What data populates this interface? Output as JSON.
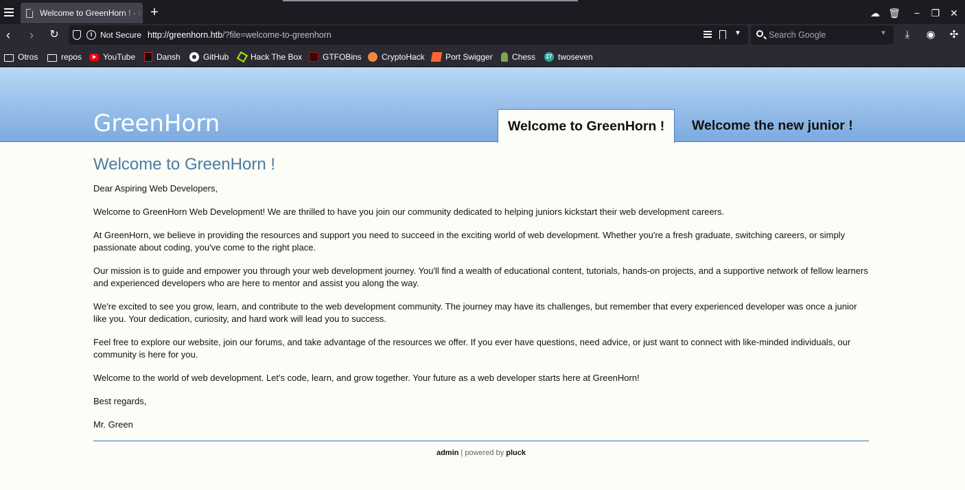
{
  "browser": {
    "tab_title": "Welcome to GreenHorn ! - GreenHorn",
    "new_tab_icon": "plus-icon",
    "url_security": "Not Secure",
    "url_host": "http://greenhorn.htb",
    "url_path": "/?file=welcome-to-greenhorn",
    "search_placeholder": "Search Google",
    "bookmarks": [
      {
        "label": "Otros",
        "icon": "folder-icon"
      },
      {
        "label": "repos",
        "icon": "folder-icon"
      },
      {
        "label": "YouTube",
        "icon": "youtube-icon"
      },
      {
        "label": "Dansh",
        "icon": "dansh-icon"
      },
      {
        "label": "GitHub",
        "icon": "github-icon"
      },
      {
        "label": "Hack The Box",
        "icon": "hackthebox-icon"
      },
      {
        "label": "GTFOBins",
        "icon": "gtfobins-icon"
      },
      {
        "label": "CryptoHack",
        "icon": "cryptohack-icon"
      },
      {
        "label": "Port Swigger",
        "icon": "portswigger-icon"
      },
      {
        "label": "Chess",
        "icon": "chess-icon"
      },
      {
        "label": "twoseven",
        "icon": "twoseven-icon"
      }
    ],
    "twoseven_glyph": "27"
  },
  "site": {
    "title": "GreenHorn",
    "nav": [
      {
        "label": "Welcome to GreenHorn !",
        "active": true
      },
      {
        "label": "Welcome the new junior !",
        "active": false
      }
    ]
  },
  "page": {
    "heading": "Welcome to GreenHorn !",
    "paragraphs": [
      "Dear Aspiring Web Developers,",
      "Welcome to GreenHorn Web Development! We are thrilled to have you join our community dedicated to helping juniors kickstart their web development careers.",
      "At GreenHorn, we believe in providing the resources and support you need to succeed in the exciting world of web development. Whether you're a fresh graduate, switching careers, or simply passionate about coding, you've come to the right place.",
      "Our mission is to guide and empower you through your web development journey. You'll find a wealth of educational content, tutorials, hands-on projects, and a supportive network of fellow learners and experienced developers who are here to mentor and assist you along the way.",
      "We're excited to see you grow, learn, and contribute to the web development community. The journey may have its challenges, but remember that every experienced developer was once a junior like you. Your dedication, curiosity, and hard work will lead you to success.",
      "Feel free to explore our website, join our forums, and take advantage of the resources we offer. If you ever have questions, need advice, or just want to connect with like-minded individuals, our community is here for you.",
      "Welcome to the world of web development. Let's code, learn, and grow together. Your future as a web developer starts here at GreenHorn!",
      "Best regards,",
      "Mr. Green"
    ]
  },
  "footer": {
    "admin_label": "admin",
    "separator": " | powered by ",
    "pluck_label": "pluck"
  },
  "colors": {
    "header_top": "#b9d7f5",
    "header_bottom": "#7aa8dd",
    "heading": "#4a7ba3",
    "page_bg": "#fcfdf6"
  }
}
